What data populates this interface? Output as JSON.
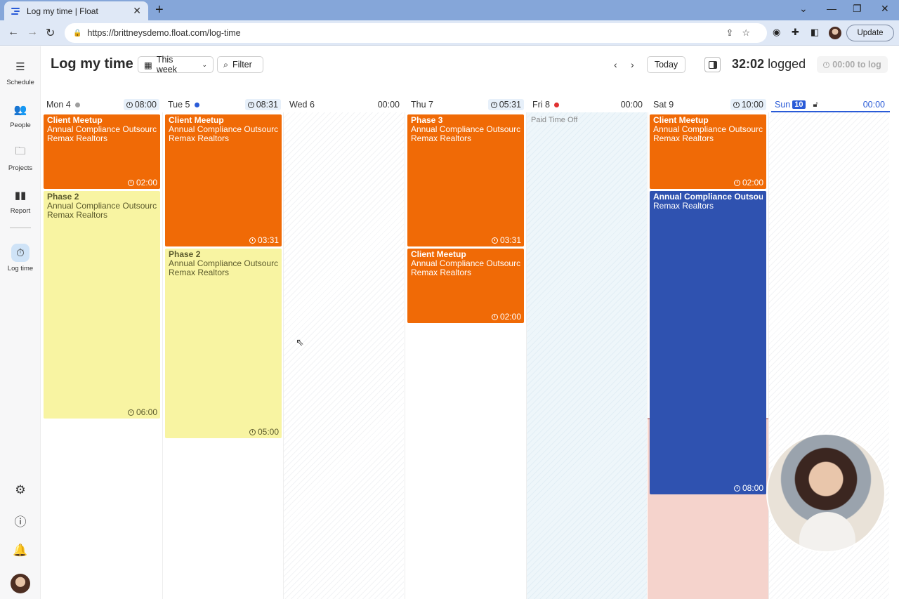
{
  "browser": {
    "tab_title": "Log my time | Float",
    "url": "https://brittneysdemo.float.com/log-time",
    "update_label": "Update"
  },
  "nav": {
    "items": [
      {
        "label": "Schedule",
        "icon": "schedule-icon"
      },
      {
        "label": "People",
        "icon": "people-icon"
      },
      {
        "label": "Projects",
        "icon": "folder-icon"
      },
      {
        "label": "Report",
        "icon": "bar-chart-icon"
      },
      {
        "label": "Log time",
        "icon": "stopwatch-icon"
      }
    ]
  },
  "header": {
    "title": "Log my time",
    "range_label": "This week",
    "filter_label": "Filter",
    "today_label": "Today",
    "logged_value": "32:02",
    "logged_label": "logged",
    "to_log": "00:00 to log"
  },
  "days": [
    {
      "name": "Mon 4",
      "total": "08:00",
      "dot_color": "#9e9e9e"
    },
    {
      "name": "Tue 5",
      "total": "08:31",
      "dot_color": "#2a5bd7"
    },
    {
      "name": "Wed 6",
      "total": "00:00"
    },
    {
      "name": "Thu 7",
      "total": "05:31"
    },
    {
      "name": "Fri 8",
      "total": "00:00",
      "dot_color": "#e03131"
    },
    {
      "name": "Sat 9",
      "total": "10:00"
    },
    {
      "name": "Sun",
      "today_num": "10",
      "total": "00:00"
    }
  ],
  "pto_label": "Paid Time Off",
  "entries": {
    "mon_1": {
      "name": "Client Meetup",
      "project": "Annual Compliance Outsourcing",
      "client": "Remax Realtors",
      "duration": "02:00"
    },
    "mon_2": {
      "name": "Phase 2",
      "project": "Annual Compliance Outsourcing",
      "client": "Remax Realtors",
      "duration": "06:00"
    },
    "tue_1": {
      "name": "Client Meetup",
      "project": "Annual Compliance Outsourcing",
      "client": "Remax Realtors",
      "duration": "03:31"
    },
    "tue_2": {
      "name": "Phase 2",
      "project": "Annual Compliance Outsourcing",
      "client": "Remax Realtors",
      "duration": "05:00"
    },
    "thu_1": {
      "name": "Phase 3",
      "project": "Annual Compliance Outsourcing",
      "client": "Remax Realtors",
      "duration": "03:31"
    },
    "thu_2": {
      "name": "Client Meetup",
      "project": "Annual Compliance Outsourcing",
      "client": "Remax Realtors",
      "duration": "02:00"
    },
    "sat_1": {
      "name": "Client Meetup",
      "project": "Annual Compliance Outsourcing",
      "client": "Remax Realtors",
      "duration": "02:00"
    },
    "sat_2": {
      "name": "Annual Compliance Outsourcing",
      "client": "Remax Realtors",
      "duration": "08:00"
    }
  },
  "colors": {
    "orange": "#f06a06",
    "yellow": "#f8f4a2",
    "blue": "#2f52b0",
    "accent": "#2a5bd7"
  }
}
